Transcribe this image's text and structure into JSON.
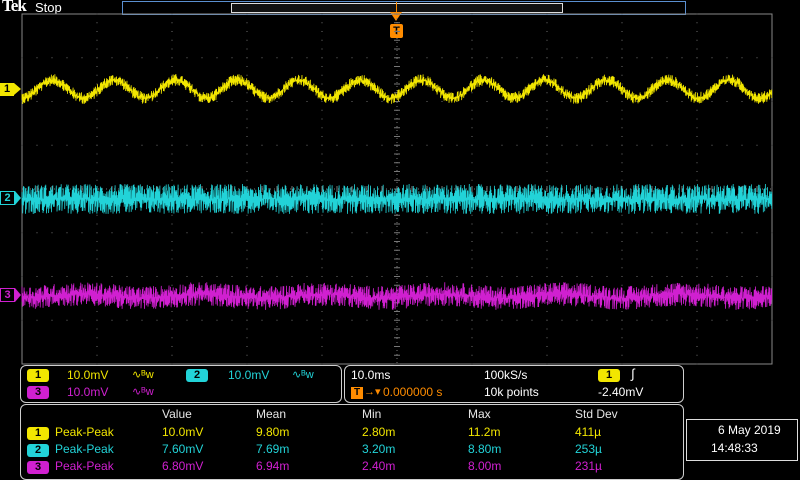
{
  "header": {
    "brand": "Tek",
    "acq_state": "Stop",
    "trigger_marker": "T"
  },
  "colors": {
    "ch1": "#f2e600",
    "ch2": "#22d3d8",
    "ch3": "#d020d0",
    "grid": "#6e6e6e",
    "trigger": "#ff8c00"
  },
  "channels": [
    {
      "id": "1",
      "scale": "10.0mV",
      "coupling_icon": "ac-bandwidth-icon",
      "coupling_glyph": "∿ᴮw"
    },
    {
      "id": "2",
      "scale": "10.0mV",
      "coupling_icon": "ac-bandwidth-icon",
      "coupling_glyph": "∿ᴮw"
    },
    {
      "id": "3",
      "scale": "10.0mV",
      "coupling_icon": "ac-bandwidth-icon",
      "coupling_glyph": "∿ᴮw"
    }
  ],
  "timebase": {
    "scale": "10.0ms",
    "sample_rate": "100kS/s",
    "trigger_position": "0.000000 s",
    "record_length": "10k points",
    "trigger_source": "1",
    "trigger_slope_glyph": "∫",
    "trigger_level": "-2.40mV"
  },
  "measurements": {
    "headers": [
      "Value",
      "Mean",
      "Min",
      "Max",
      "Std Dev"
    ],
    "rows": [
      {
        "ch": "1",
        "type": "Peak-Peak",
        "value": "10.0mV",
        "mean": "9.80m",
        "min": "2.80m",
        "max": "11.2m",
        "std": "411µ"
      },
      {
        "ch": "2",
        "type": "Peak-Peak",
        "value": "7.60mV",
        "mean": "7.69m",
        "min": "3.20m",
        "max": "8.80m",
        "std": "253µ"
      },
      {
        "ch": "3",
        "type": "Peak-Peak",
        "value": "6.80mV",
        "mean": "6.94m",
        "min": "2.40m",
        "max": "8.00m",
        "std": "231µ"
      }
    ]
  },
  "datetime": {
    "date": "6 May 2019",
    "time": "14:48:33"
  }
}
